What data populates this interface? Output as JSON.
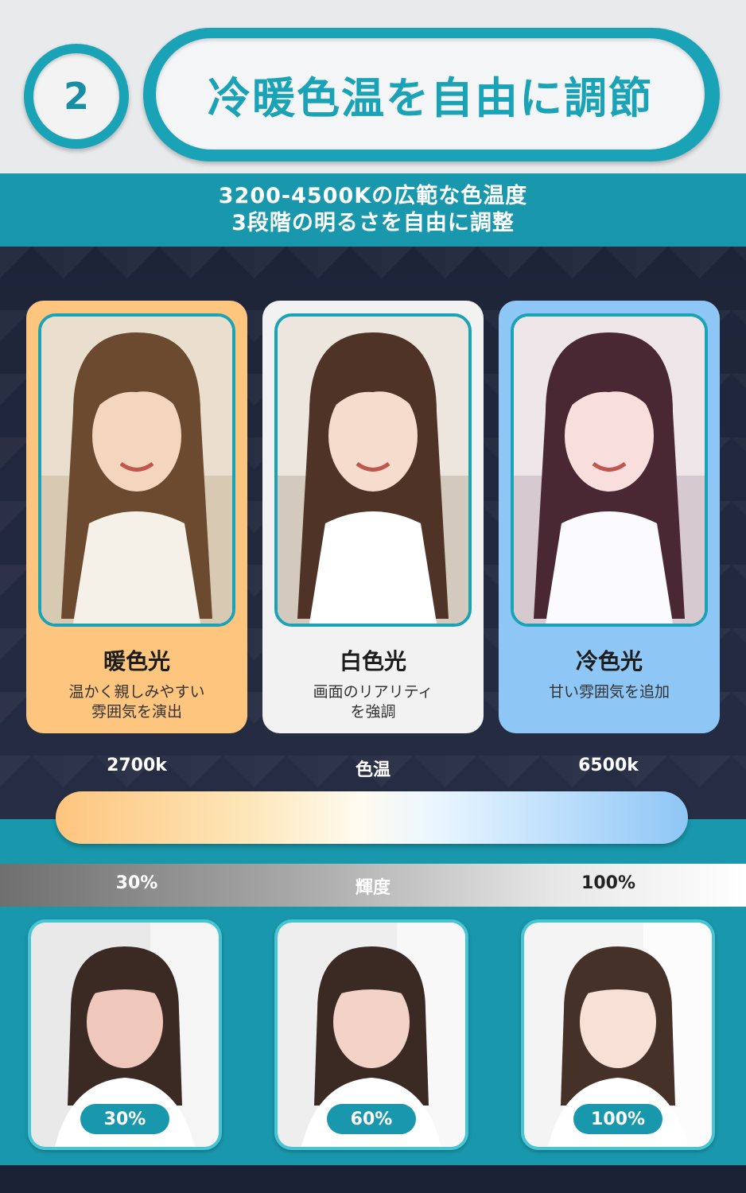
{
  "header": {
    "step_number": "2",
    "title": "冷暖色温を自由に調節"
  },
  "subtitle": {
    "line1": "3200-4500Kの広範な色温度",
    "line2": "3段階の明るさを自由に調整"
  },
  "modes": [
    {
      "title": "暖色光",
      "desc": [
        "温かく親しみやすい",
        "雰囲気を演出"
      ],
      "color": "#fec57e"
    },
    {
      "title": "白色光",
      "desc": [
        "画面のリアリティ",
        "を強調"
      ],
      "color": "#f2f2f2"
    },
    {
      "title": "冷色光",
      "desc": [
        "甘い雰囲気を追加"
      ],
      "color": "#8ec6f6"
    }
  ],
  "temperature": {
    "min_label": "2700k",
    "center_label": "色温",
    "max_label": "6500k"
  },
  "brightness": {
    "min_label": "30%",
    "center_label": "輝度",
    "max_label": "100%",
    "levels": [
      "30%",
      "60%",
      "100%"
    ],
    "level_values": [
      0.3,
      0.6,
      1.0
    ]
  },
  "colors": {
    "accent": "#1aa3b6",
    "dark_bg": "#1c2236",
    "warm": "#fec57e",
    "cool": "#8ec6f6"
  }
}
